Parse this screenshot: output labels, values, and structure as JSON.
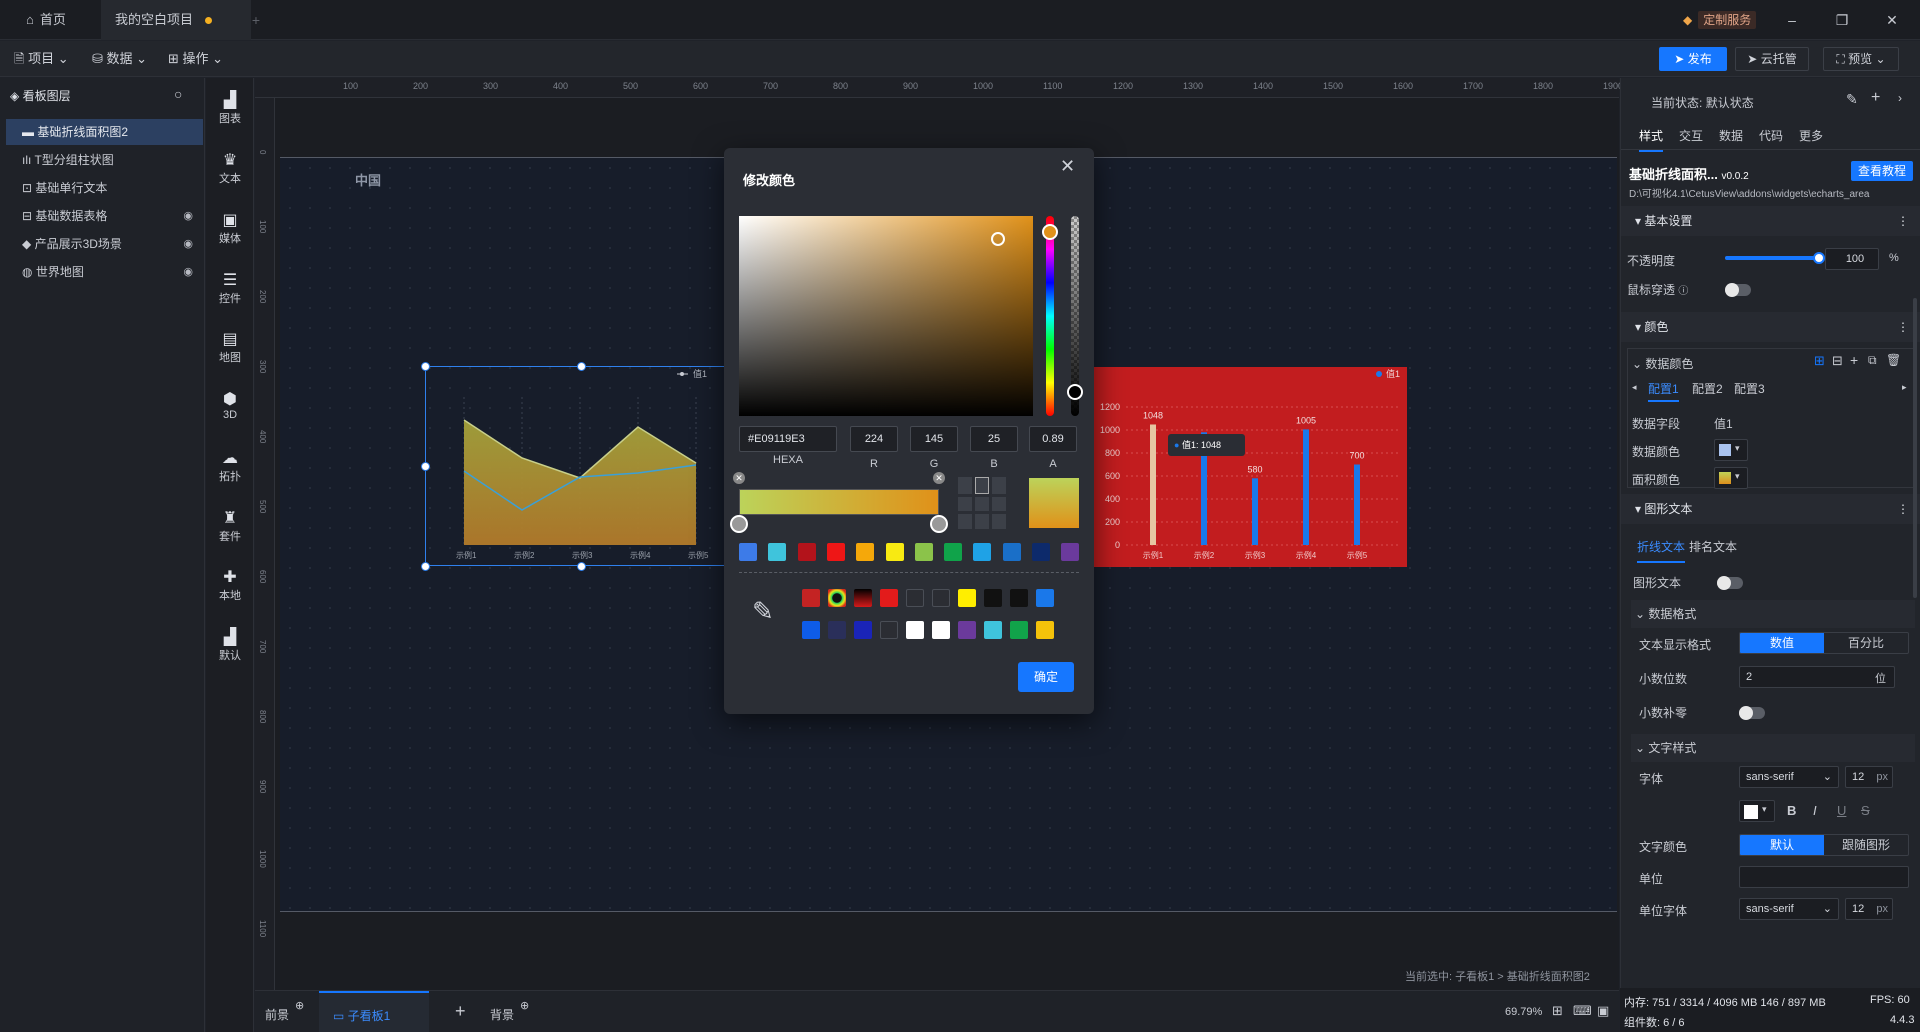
{
  "titlebar": {
    "home_tab": "首页",
    "project_tab": "我的空白项目",
    "custom_service": "定制服务"
  },
  "toolbar": {
    "menu_project": "项目",
    "menu_data": "数据",
    "menu_operate": "操作",
    "publish": "发布",
    "cloud_host": "云托管",
    "preview": "预览"
  },
  "layers": {
    "title": "看板图层",
    "items": [
      {
        "label": "基础折线面积图2"
      },
      {
        "label": "T型分组柱状图"
      },
      {
        "label": "基础单行文本"
      },
      {
        "label": "基础数据表格"
      },
      {
        "label": "产品展示3D场景"
      },
      {
        "label": "世界地图"
      }
    ]
  },
  "iconcol": {
    "items": [
      "图表",
      "文本",
      "媒体",
      "控件",
      "地图",
      "3D",
      "拓扑",
      "套件",
      "本地",
      "默认"
    ]
  },
  "ruler": {
    "top": [
      "100",
      "200",
      "300",
      "400",
      "500",
      "600",
      "700",
      "800",
      "900",
      "1000",
      "1100",
      "1200",
      "1300",
      "1400",
      "1500",
      "1600",
      "1700",
      "1800",
      "1900"
    ],
    "left": [
      "0",
      "100",
      "200",
      "300",
      "400",
      "500",
      "600",
      "700",
      "800",
      "900",
      "1000",
      "1100"
    ]
  },
  "canvas": {
    "china_label": "中国",
    "area_legend": "值1",
    "area_categories": [
      "示例1",
      "示例2",
      "示例3",
      "示例4",
      "示例5"
    ],
    "bar_legend": "值1",
    "bar_y_ticks": [
      "1200",
      "1000",
      "800",
      "600",
      "400",
      "200",
      "0"
    ],
    "bar_categories": [
      "示例1",
      "示例2",
      "示例3",
      "示例4",
      "示例5"
    ],
    "bar_labels": [
      "1048",
      "",
      "580",
      "1005",
      "700"
    ],
    "tooltip_label": "值1:",
    "tooltip_value": "1048",
    "breadcrumb": "当前选中: 子看板1 > 基础折线面积图2"
  },
  "bottom": {
    "front": "前景",
    "sub_board": "子看板1",
    "background": "背景",
    "zoom": "69.79%"
  },
  "dialog": {
    "title": "修改颜色",
    "hex_value": "#E09119E3",
    "hex_label": "HEXA",
    "r": "224",
    "g": "145",
    "b": "25",
    "a": "0.89",
    "r_label": "R",
    "g_label": "G",
    "b_label": "B",
    "a_label": "A",
    "confirm": "确定",
    "current_color": "#e09119",
    "preset_row": [
      "#3d7be8",
      "#3fc4dc",
      "#b3131b",
      "#ee1616",
      "#f5a80a",
      "#f8ea12",
      "#8bc34a",
      "#10a34a",
      "#1fa2e6",
      "#1a6fc8",
      "#0d2a6b",
      "#6b3a9c"
    ],
    "history_row1": [
      "#c42323",
      "#rainbow",
      "#black-red",
      "#e31b1b",
      "#2b2d33",
      "#2b2d33",
      "#ffee00",
      "#111111",
      "#111111",
      "#1a78ea"
    ],
    "history_row2": [
      "#0e5ce8",
      "#2a2f5a",
      "#1a24b8",
      "#2b2d33",
      "#ffffff",
      "#ffffff",
      "#6b3a9c",
      "#3fc4dc",
      "#11a34a",
      "#f5c20a"
    ]
  },
  "rpanel": {
    "state_label": "当前状态:",
    "state_value": "默认状态",
    "tabs": [
      "样式",
      "交互",
      "数据",
      "代码",
      "更多"
    ],
    "component_name": "基础折线面积...",
    "version": "v0.0.2",
    "tutorial": "查看教程",
    "path": "D:\\可视化4.1\\CetusView\\addons\\widgets\\echarts_area",
    "sec_basic": "基本设置",
    "opacity_label": "不透明度",
    "opacity_value": "100",
    "opacity_unit": "%",
    "opacity_fraction": 1.0,
    "mouse_through": "鼠标穿透",
    "sec_color": "颜色",
    "data_color_title": "数据颜色",
    "configs": [
      "配置1",
      "配置2",
      "配置3"
    ],
    "data_field_label": "数据字段",
    "data_field_value": "值1",
    "data_color_label": "数据颜色",
    "area_color_label": "面积颜色",
    "sec_shape_text": "图形文本",
    "subtabs": [
      "折线文本",
      "排名文本"
    ],
    "shape_text_label": "图形文本",
    "sec_data_format": "数据格式",
    "text_format_label": "文本显示格式",
    "format_value": "数值",
    "format_percent": "百分比",
    "decimal_label": "小数位数",
    "decimal_value": "2",
    "decimal_unit": "位",
    "pad_zero_label": "小数补零",
    "sec_text_style": "文字样式",
    "font_label": "字体",
    "font_value": "sans-serif",
    "font_size": "12",
    "font_unit": "px",
    "text_color_label": "文字颜色",
    "text_color_default": "默认",
    "text_color_follow": "跟随图形",
    "unit_label": "单位",
    "unit_font_label": "单位字体",
    "unit_font_value": "sans-serif",
    "unit_font_size": "12",
    "unit_font_unit": "px"
  },
  "status": {
    "memory": "内存:  751 / 3314 / 4096 MB  146 / 897 MB",
    "fps": "FPS:  60",
    "components": "组件数: 6 / 6",
    "version": "4.4.3"
  }
}
